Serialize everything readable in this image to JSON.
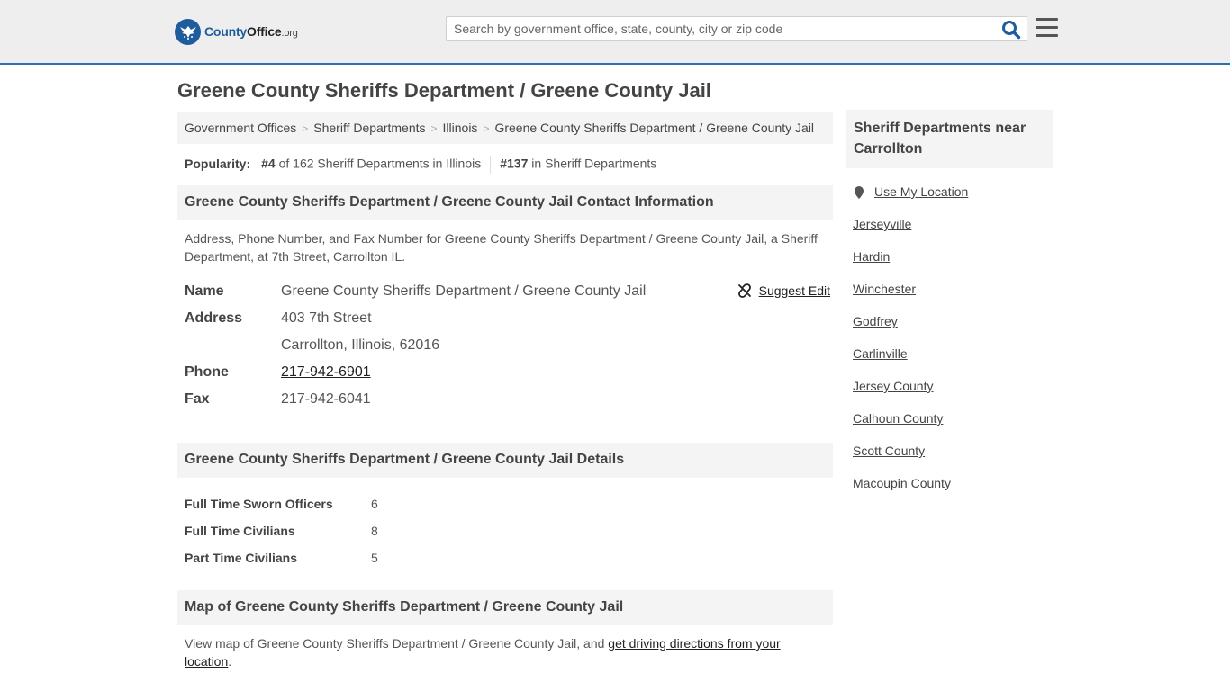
{
  "header": {
    "logo": {
      "main": "County",
      "bold": "Office",
      "domain": ".org"
    },
    "search_placeholder": "Search by government office, state, county, city or zip code"
  },
  "page_title": "Greene County Sheriffs Department / Greene County Jail",
  "breadcrumb": [
    "Government Offices",
    "Sheriff Departments",
    "Illinois",
    "Greene County Sheriffs Department / Greene County Jail"
  ],
  "popularity": {
    "label": "Popularity:",
    "state_rank": "#4",
    "state_text": "of 162 Sheriff Departments in Illinois",
    "national_rank": "#137",
    "national_text": "in Sheriff Departments"
  },
  "contact": {
    "heading": "Greene County Sheriffs Department / Greene County Jail Contact Information",
    "description": "Address, Phone Number, and Fax Number for Greene County Sheriffs Department / Greene County Jail, a Sheriff Department, at 7th Street, Carrollton IL.",
    "suggest_edit": "Suggest Edit",
    "name_label": "Name",
    "name": "Greene County Sheriffs Department / Greene County Jail",
    "address_label": "Address",
    "address_line1": "403 7th Street",
    "address_line2": "Carrollton, Illinois, 62016",
    "phone_label": "Phone",
    "phone": "217-942-6901",
    "fax_label": "Fax",
    "fax": "217-942-6041"
  },
  "details": {
    "heading": "Greene County Sheriffs Department / Greene County Jail Details",
    "rows": [
      {
        "label": "Full Time Sworn Officers",
        "value": "6"
      },
      {
        "label": "Full Time Civilians",
        "value": "8"
      },
      {
        "label": "Part Time Civilians",
        "value": "5"
      }
    ]
  },
  "map": {
    "heading": "Map of Greene County Sheriffs Department / Greene County Jail",
    "text": "View map of Greene County Sheriffs Department / Greene County Jail, and",
    "link": "get driving directions from your location",
    "end": "."
  },
  "sidebar": {
    "heading": "Sheriff Departments near Carrollton",
    "use_location": "Use My Location",
    "links": [
      "Jerseyville",
      "Hardin",
      "Winchester",
      "Godfrey",
      "Carlinville",
      "Jersey County",
      "Calhoun County",
      "Scott County",
      "Macoupin County"
    ]
  },
  "colors": {
    "brand_blue": "#1f5c9e",
    "header_bg": "#eeeeef",
    "panel_bg": "#f4f4f4"
  }
}
